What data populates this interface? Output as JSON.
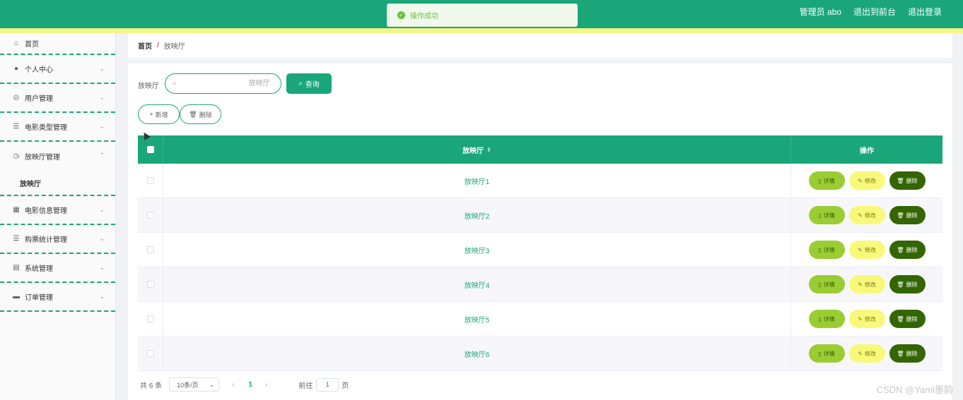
{
  "header": {
    "admin_label": "管理员 abo",
    "back_label": "退出到前台",
    "logout_label": "退出登录"
  },
  "toast": {
    "message": "操作成功"
  },
  "sidebar": {
    "items": [
      {
        "label": "首页",
        "icon": "home-icon"
      },
      {
        "label": "个人中心",
        "icon": "user-icon"
      },
      {
        "label": "用户管理",
        "icon": "users-icon"
      },
      {
        "label": "电影类型管理",
        "icon": "menu-icon"
      },
      {
        "label": "放映厅管理",
        "icon": "compass-icon"
      },
      {
        "label": "电影信息管理",
        "icon": "grid-icon"
      },
      {
        "label": "购票统计管理",
        "icon": "menu-icon"
      },
      {
        "label": "系统管理",
        "icon": "chart-icon"
      },
      {
        "label": "订单管理",
        "icon": "monitor-icon"
      }
    ],
    "sub_item": "放映厅"
  },
  "breadcrumb": {
    "home": "首页",
    "separator": "/",
    "current": "放映厅"
  },
  "search": {
    "label": "放映厅",
    "placeholder": "放映厅",
    "query_label": "查询"
  },
  "toolbar": {
    "add_label": "新增",
    "delete_label": "删除"
  },
  "table": {
    "headers": {
      "name": "放映厅",
      "actions": "操作"
    },
    "rows": [
      {
        "name": "放映厅1"
      },
      {
        "name": "放映厅2"
      },
      {
        "name": "放映厅3"
      },
      {
        "name": "放映厅4"
      },
      {
        "name": "放映厅5"
      },
      {
        "name": "放映厅6"
      }
    ],
    "actions": {
      "detail": "详情",
      "edit": "修改",
      "delete": "删除"
    }
  },
  "pagination": {
    "total": "共 6 条",
    "page_size": "10条/页",
    "current_page": "1",
    "goto_label": "前往",
    "goto_value": "1",
    "page_suffix": "页"
  },
  "watermark": "CSDN @Yaml墨韵",
  "colors": {
    "primary": "#1aa679",
    "stripe": "#f5f58a",
    "detail": "#9acd32",
    "edit": "#f8f97a",
    "delete": "#336600"
  }
}
